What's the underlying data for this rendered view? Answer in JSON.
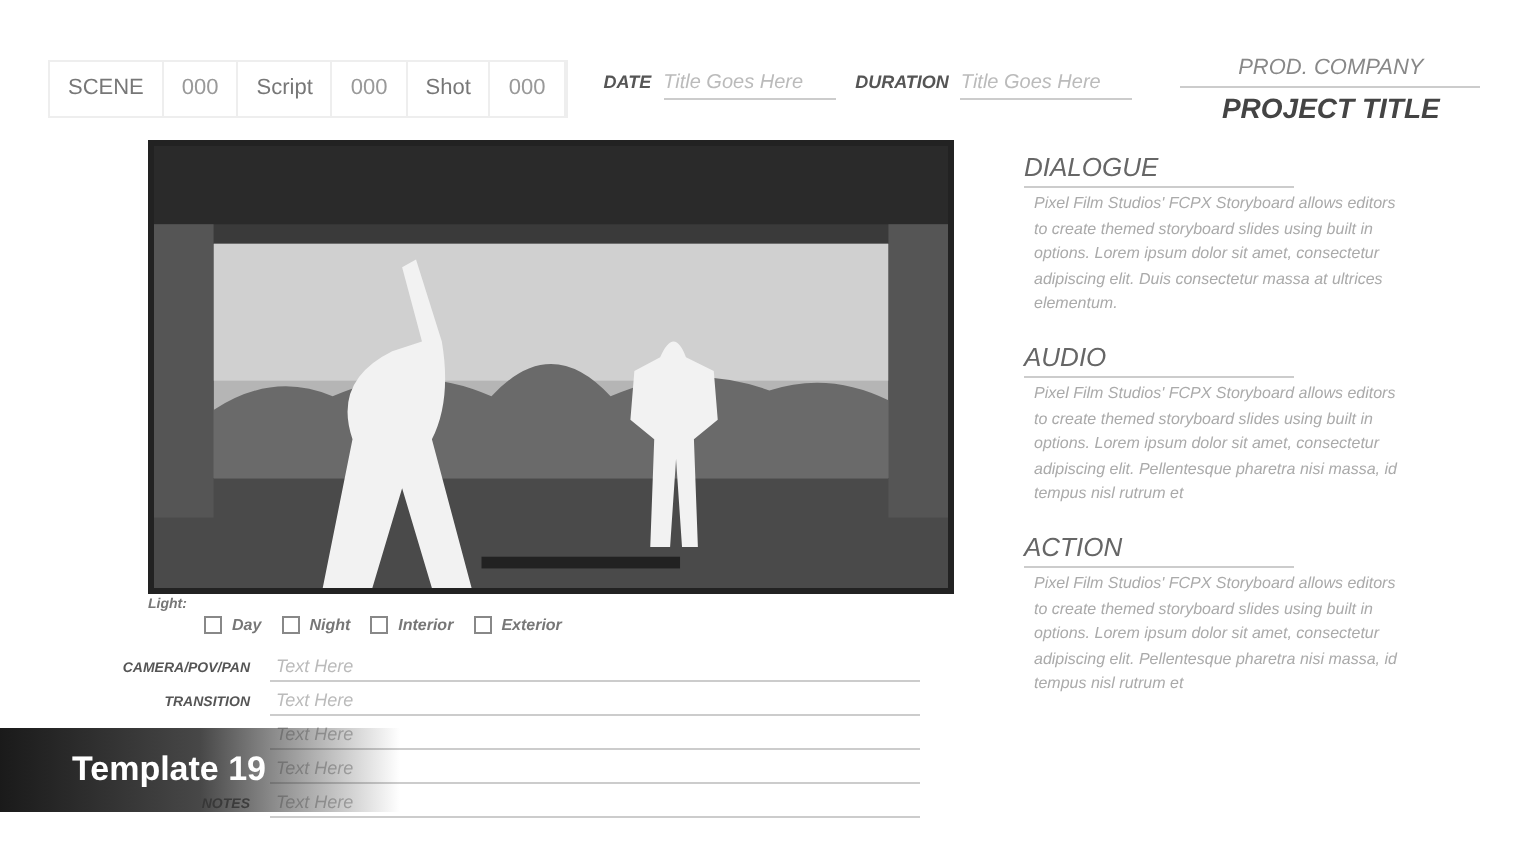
{
  "header": {
    "cells": [
      {
        "kind": "label",
        "text": "SCENE"
      },
      {
        "kind": "value",
        "text": "000"
      },
      {
        "kind": "label",
        "text": "Script"
      },
      {
        "kind": "value",
        "text": "000"
      },
      {
        "kind": "label",
        "text": "Shot"
      },
      {
        "kind": "value",
        "text": "000"
      }
    ],
    "date": {
      "label": "DATE",
      "placeholder": "Title Goes Here"
    },
    "duration": {
      "label": "DURATION",
      "placeholder": "Title Goes Here"
    },
    "company": "PROD. COMPANY",
    "project": "PROJECT TITLE"
  },
  "light": {
    "label": "Light:",
    "options": [
      {
        "label": "Day",
        "checked": false
      },
      {
        "label": "Night",
        "checked": false
      },
      {
        "label": "Interior",
        "checked": false
      },
      {
        "label": "Exterior",
        "checked": false
      }
    ]
  },
  "fields": [
    {
      "label": "CAMERA/POV/PAN",
      "placeholder": "Text Here"
    },
    {
      "label": "TRANSITION",
      "placeholder": "Text Here"
    },
    {
      "placeholder": "Text Here"
    },
    {
      "placeholder": "Text Here"
    },
    {
      "label": "NOTES",
      "placeholder": "Text Here"
    }
  ],
  "sections": [
    {
      "title": "DIALOGUE",
      "body": "Pixel Film Studios' FCPX Storyboard allows editors to create themed storyboard slides using built in options. Lorem ipsum dolor sit amet, consectetur adipiscing elit. Duis consectetur massa at ultrices elementum."
    },
    {
      "title": "AUDIO",
      "body": "Pixel Film Studios' FCPX Storyboard allows editors to create themed storyboard slides using built in options. Lorem ipsum dolor sit amet, consectetur adipiscing elit. Pellentesque pharetra nisi massa, id tempus nisl rutrum et"
    },
    {
      "title": "ACTION",
      "body": "Pixel Film Studios' FCPX Storyboard allows editors to create themed storyboard slides using built in options. Lorem ipsum dolor sit amet, consectetur adipiscing elit. Pellentesque pharetra nisi massa, id tempus nisl rutrum et"
    }
  ],
  "banner": "Template 19"
}
